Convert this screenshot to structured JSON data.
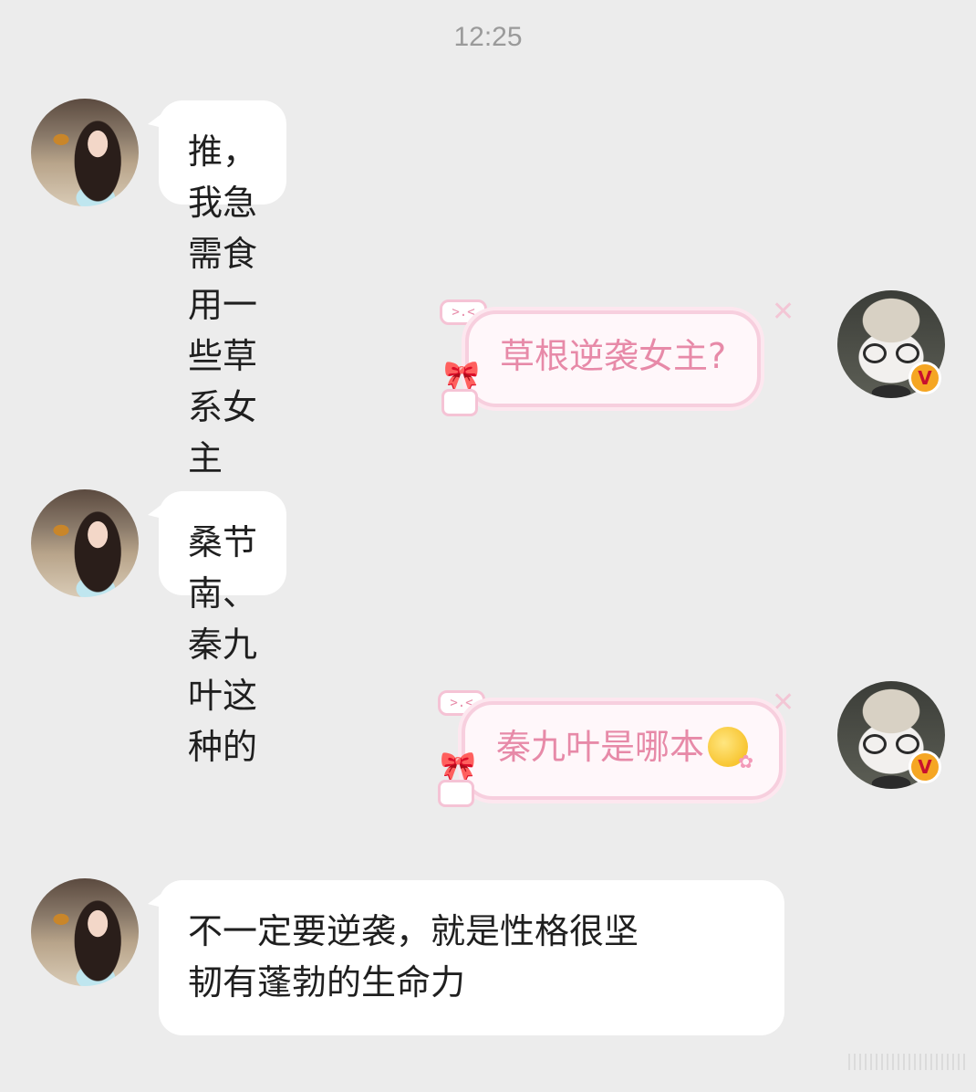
{
  "header": {
    "time": "12:25"
  },
  "messages": [
    {
      "side": "left",
      "text": "推，我急需食用一些草系女主"
    },
    {
      "side": "right",
      "text": "草根逆袭女主?"
    },
    {
      "side": "left",
      "text": "桑节南、秦九叶这种的"
    },
    {
      "side": "right",
      "text": "秦九叶是哪本",
      "emoji": "flower-face-emoji-icon"
    },
    {
      "side": "left",
      "text_lines": [
        "不一定要逆袭，就是性格很坚",
        "韧有蓬勃的生命力"
      ]
    }
  ],
  "bubble_decoration": {
    "tag": ">.<"
  },
  "colors": {
    "background": "#ececec",
    "left_bubble": "#ffffff",
    "right_bubble_text": "#e78aa8",
    "right_bubble_border": "#f7cfde",
    "verified_badge": "#f5a623"
  },
  "icons": {
    "left_avatar": "girl-avatar",
    "right_avatar": "cat-avatar",
    "badge": "verified-v-badge-icon"
  }
}
